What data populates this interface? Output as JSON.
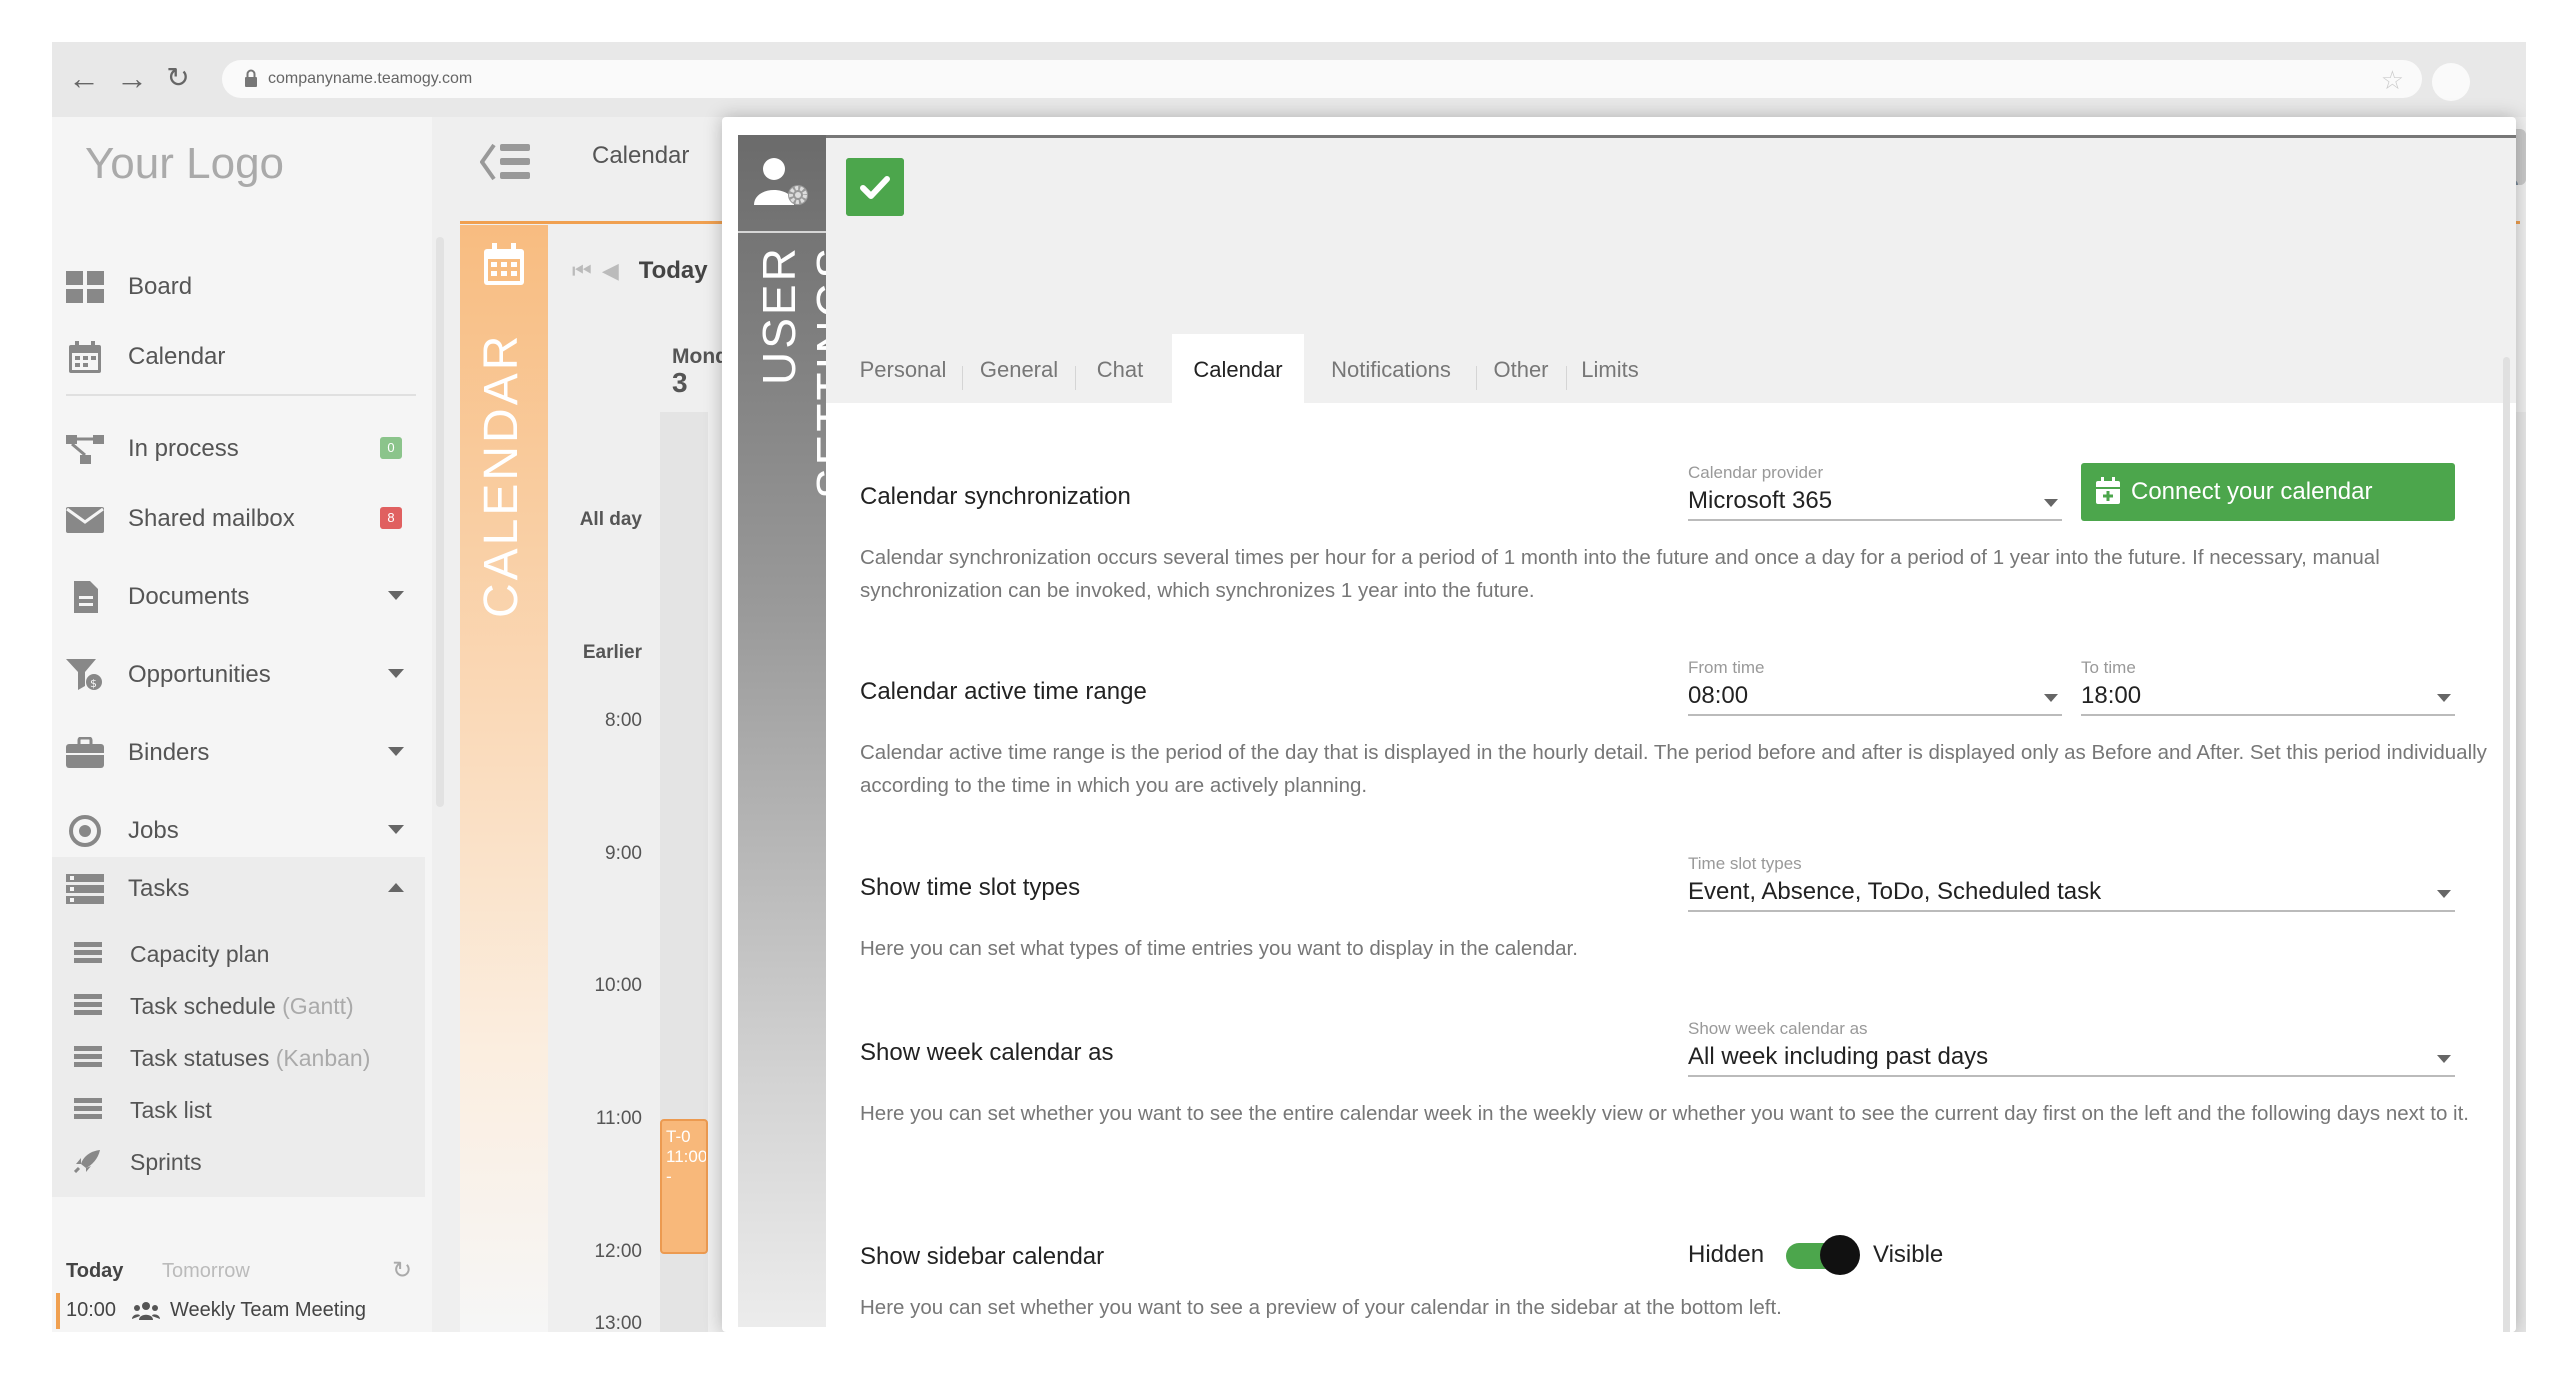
{
  "browser": {
    "url": "companyname.teamogy.com",
    "back_icon": "arrow-left",
    "forward_icon": "arrow-right",
    "reload_icon": "reload"
  },
  "app": {
    "logo": "Your Logo",
    "breadcrumb": "Calendar",
    "nav": [
      {
        "label": "Board",
        "icon": "board-icon"
      },
      {
        "label": "Calendar",
        "icon": "calendar-icon"
      },
      {
        "label": "In process",
        "icon": "process-icon",
        "badge": "0",
        "badge_color": "#8bc48b"
      },
      {
        "label": "Shared mailbox",
        "icon": "mail-icon",
        "badge": "8",
        "badge_color": "#e06060"
      },
      {
        "label": "Documents",
        "icon": "document-icon"
      },
      {
        "label": "Opportunities",
        "icon": "opportunities-icon"
      },
      {
        "label": "Binders",
        "icon": "briefcase-icon"
      },
      {
        "label": "Jobs",
        "icon": "target-icon"
      },
      {
        "label": "Tasks",
        "icon": "tasks-icon"
      }
    ],
    "tasks_sub": [
      {
        "label": "Capacity plan",
        "suffix": ""
      },
      {
        "label": "Task schedule",
        "suffix": "(Gantt)"
      },
      {
        "label": "Task statuses",
        "suffix": "(Kanban)"
      },
      {
        "label": "Task list",
        "suffix": ""
      },
      {
        "label": "Sprints",
        "suffix": ""
      }
    ],
    "day_tabs": {
      "today": "Today",
      "tomorrow": "Tomorrow"
    },
    "sidebar_event": {
      "time": "10:00",
      "title": "Weekly Team Meeting"
    }
  },
  "calendar": {
    "strip_label": "CALENDAR",
    "today_button": "Today",
    "day_name": "Mond",
    "day_number": "3",
    "all_day": "All day",
    "earlier": "Earlier",
    "hours": [
      "8:00",
      "9:00",
      "10:00",
      "11:00",
      "12:00",
      "13:00"
    ],
    "event_line1": "T-0",
    "event_line2": "11:00 -"
  },
  "modal": {
    "rail_label": "USER SETTINGS",
    "tabs": [
      "Personal",
      "General",
      "Chat",
      "Calendar",
      "Notifications",
      "Other",
      "Limits"
    ],
    "active_tab": "Calendar",
    "sync": {
      "title": "Calendar synchronization",
      "provider_label": "Calendar provider",
      "provider_value": "Microsoft 365",
      "connect_button": "Connect your calendar",
      "desc": "Calendar synchronization occurs several times per hour for a period of 1 month into the future and once a day for a period of 1 year into the future. If necessary, manual synchronization can be invoked, which synchronizes 1 year into the future."
    },
    "range": {
      "title": "Calendar active time range",
      "from_label": "From time",
      "from_value": "08:00",
      "to_label": "To time",
      "to_value": "18:00",
      "desc": "Calendar active time range is the period of the day that is displayed in the hourly detail. The period before and after is displayed only as Before and After. Set this period individually according to the time in which you are actively planning."
    },
    "slot_types": {
      "title": "Show time slot types",
      "label": "Time slot types",
      "value": "Event,  Absence,  ToDo,  Scheduled task",
      "desc": "Here you can set what types of time entries you want to display in the calendar."
    },
    "week": {
      "title": "Show week calendar as",
      "label": "Show week calendar as",
      "value": "All week including past days",
      "desc": "Here you can set whether you want to see the entire calendar week in the weekly view or whether you want to see the current day first on the left and the following days next to it."
    },
    "sidebar_cal": {
      "title": "Show sidebar calendar",
      "off_label": "Hidden",
      "on_label": "Visible",
      "state": "Visible",
      "desc": "Here you can set whether you want to see a preview of your calendar in the sidebar at the bottom left."
    }
  },
  "colors": {
    "accent_green": "#4ca64c",
    "calendar_orange": "#f0a050"
  }
}
